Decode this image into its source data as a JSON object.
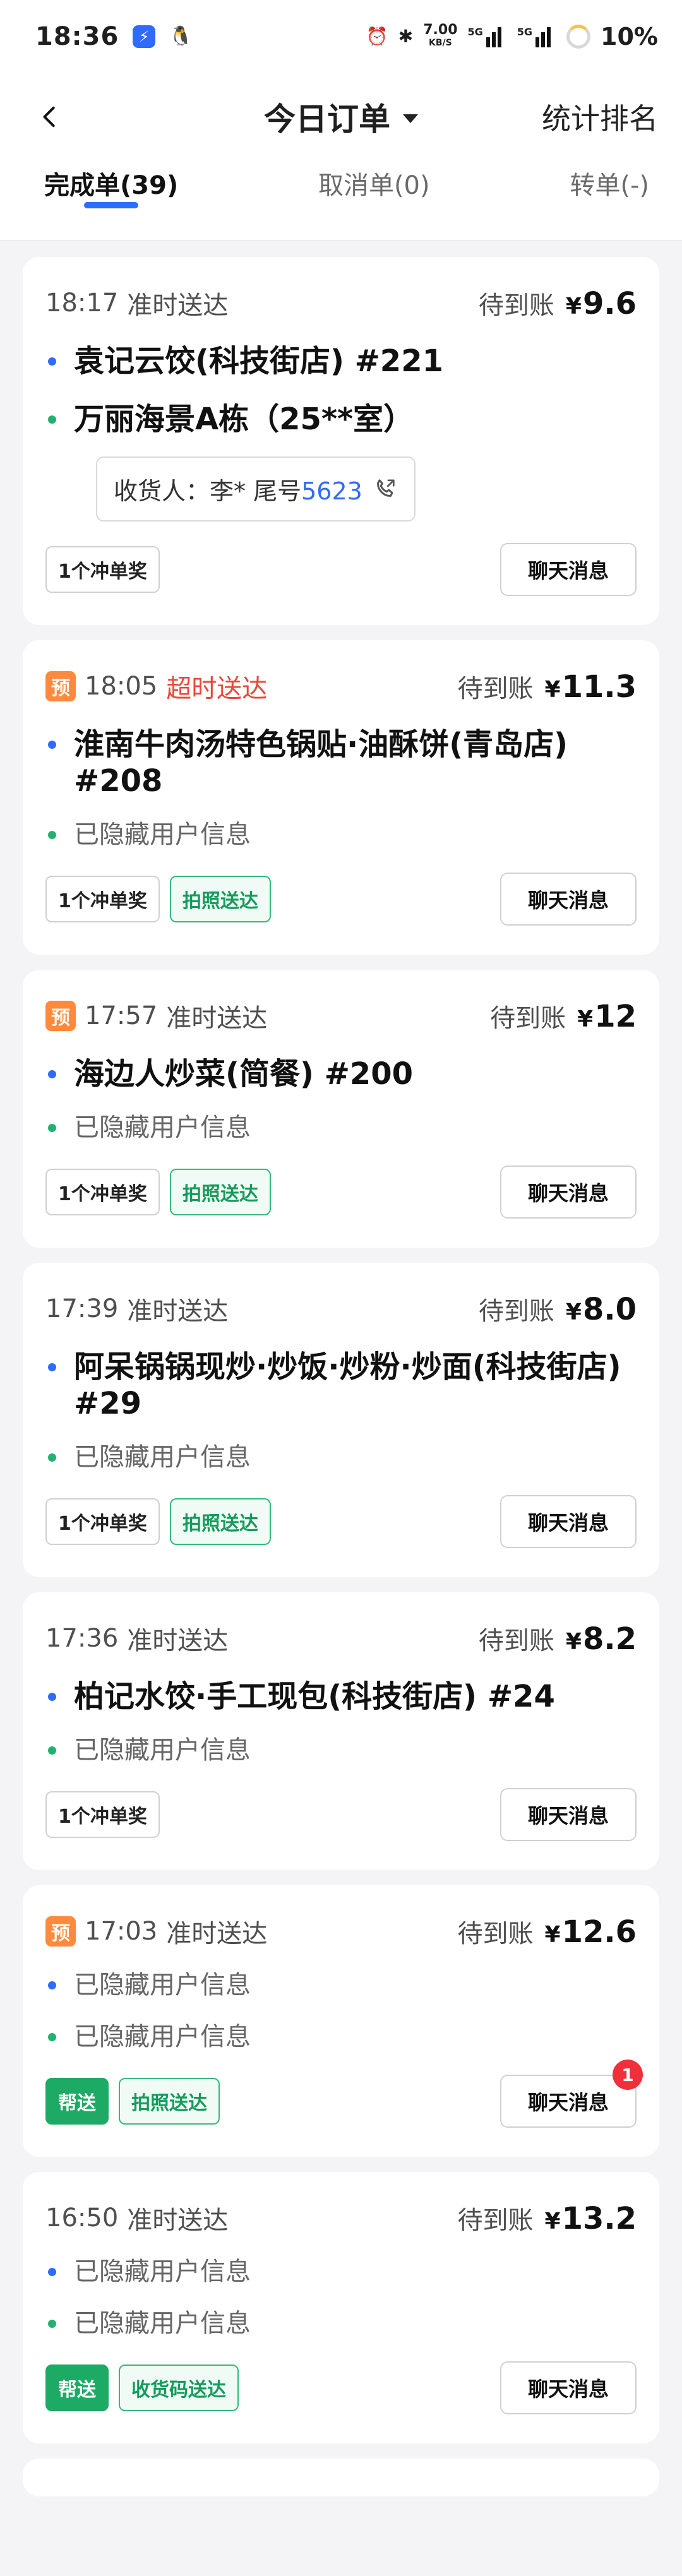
{
  "status_bar": {
    "time": "18:36",
    "network_speed": "7.00",
    "network_unit": "KB/S",
    "signal1_label": "5G",
    "signal2_label": "5G",
    "battery": "10%"
  },
  "nav": {
    "title": "今日订单",
    "right_link": "统计排名"
  },
  "tabs": [
    {
      "label": "完成单(39)"
    },
    {
      "label": "取消单(0)"
    },
    {
      "label": "转单(-)"
    }
  ],
  "labels": {
    "pending": "待到账",
    "yen": "¥",
    "chat": "聊天消息",
    "pre": "预"
  },
  "orders": [
    {
      "time": "18:17",
      "status": "准时送达",
      "amount": "9.6",
      "store": "袁记云饺(科技街店) #221",
      "dest": "万丽海景A栋（25**室）",
      "receiver_prefix": "收货人：李* 尾号",
      "receiver_phone": "5623",
      "tags": [
        "1个冲单奖"
      ]
    },
    {
      "time": "18:05",
      "status": "超时送达",
      "amount": "11.3",
      "store": "淮南牛肉汤特色锅贴·油酥饼(青岛店) #208",
      "dest": "已隐藏用户信息",
      "tags": [
        "1个冲单奖",
        "拍照送达"
      ]
    },
    {
      "time": "17:57",
      "status": "准时送达",
      "amount": "12",
      "store": "海边人炒菜(简餐) #200",
      "dest": "已隐藏用户信息",
      "tags": [
        "1个冲单奖",
        "拍照送达"
      ]
    },
    {
      "time": "17:39",
      "status": "准时送达",
      "amount": "8.0",
      "store": "阿呆锅锅现炒·炒饭·炒粉·炒面(科技街店) #29",
      "dest": "已隐藏用户信息",
      "tags": [
        "1个冲单奖",
        "拍照送达"
      ]
    },
    {
      "time": "17:36",
      "status": "准时送达",
      "amount": "8.2",
      "store": "柏记水饺·手工现包(科技街店) #24",
      "dest": "已隐藏用户信息",
      "tags": [
        "1个冲单奖"
      ]
    },
    {
      "time": "17:03",
      "status": "准时送达",
      "amount": "12.6",
      "store": "已隐藏用户信息",
      "dest": "已隐藏用户信息",
      "tags": [
        "帮送",
        "拍照送达"
      ],
      "chat_badge": "1"
    },
    {
      "time": "16:50",
      "status": "准时送达",
      "amount": "13.2",
      "store": "已隐藏用户信息",
      "dest": "已隐藏用户信息",
      "tags": [
        "帮送",
        "收货码送达"
      ]
    }
  ]
}
